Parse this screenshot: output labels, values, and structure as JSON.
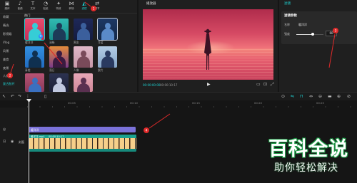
{
  "toolbar": {
    "tabs": [
      {
        "label": "媒体",
        "icon": "media-icon"
      },
      {
        "label": "音频",
        "icon": "audio-icon"
      },
      {
        "label": "文本",
        "icon": "text-icon"
      },
      {
        "label": "贴纸",
        "icon": "sticker-icon"
      },
      {
        "label": "特效",
        "icon": "effects-icon"
      },
      {
        "label": "转场",
        "icon": "transition-icon"
      },
      {
        "label": "滤镜",
        "icon": "filter-icon",
        "active": true
      },
      {
        "label": "调节",
        "icon": "adjust-icon"
      }
    ]
  },
  "sidebar": {
    "items": [
      "收藏",
      "精选",
      "影视级",
      "Vlog",
      "风景",
      "美食",
      "夜景",
      "人像",
      "复古胶片"
    ],
    "active_index": 8
  },
  "filters": {
    "section_title": "热门",
    "labels": [
      "暖洋洋",
      "清晰",
      "黑金",
      "冷蓝",
      "青橙",
      "落日",
      "人像",
      "胶片"
    ]
  },
  "player": {
    "title": "播放器",
    "current_time": "00:00:00:00",
    "duration": "00:00:10:17"
  },
  "inspector": {
    "title": "滤镜",
    "panel_title": "滤镜参数",
    "name_label": "名称",
    "name_value": "暖洋洋",
    "strength_label": "强度",
    "strength_value": "60"
  },
  "timeline": {
    "ruler": [
      "00:05",
      "00:10",
      "00:15",
      "00:20",
      "00:25"
    ],
    "filter_clip_label": "暖洋洋",
    "video_clip_label": "暖洋洋.mp4",
    "video_clip_duration": "00:00:10:17",
    "cover_label": "封面"
  },
  "annotations": [
    "1",
    "2",
    "3",
    "4"
  ],
  "watermark": {
    "title": "百科全说",
    "slogan": "助你轻松解决"
  },
  "theme": {
    "accent": "#1fd1d1",
    "filter_track": "#7b72d9",
    "video_track": "#1aa08f",
    "annotation": "#e02a2a",
    "watermark_green": "#1f9a47"
  }
}
